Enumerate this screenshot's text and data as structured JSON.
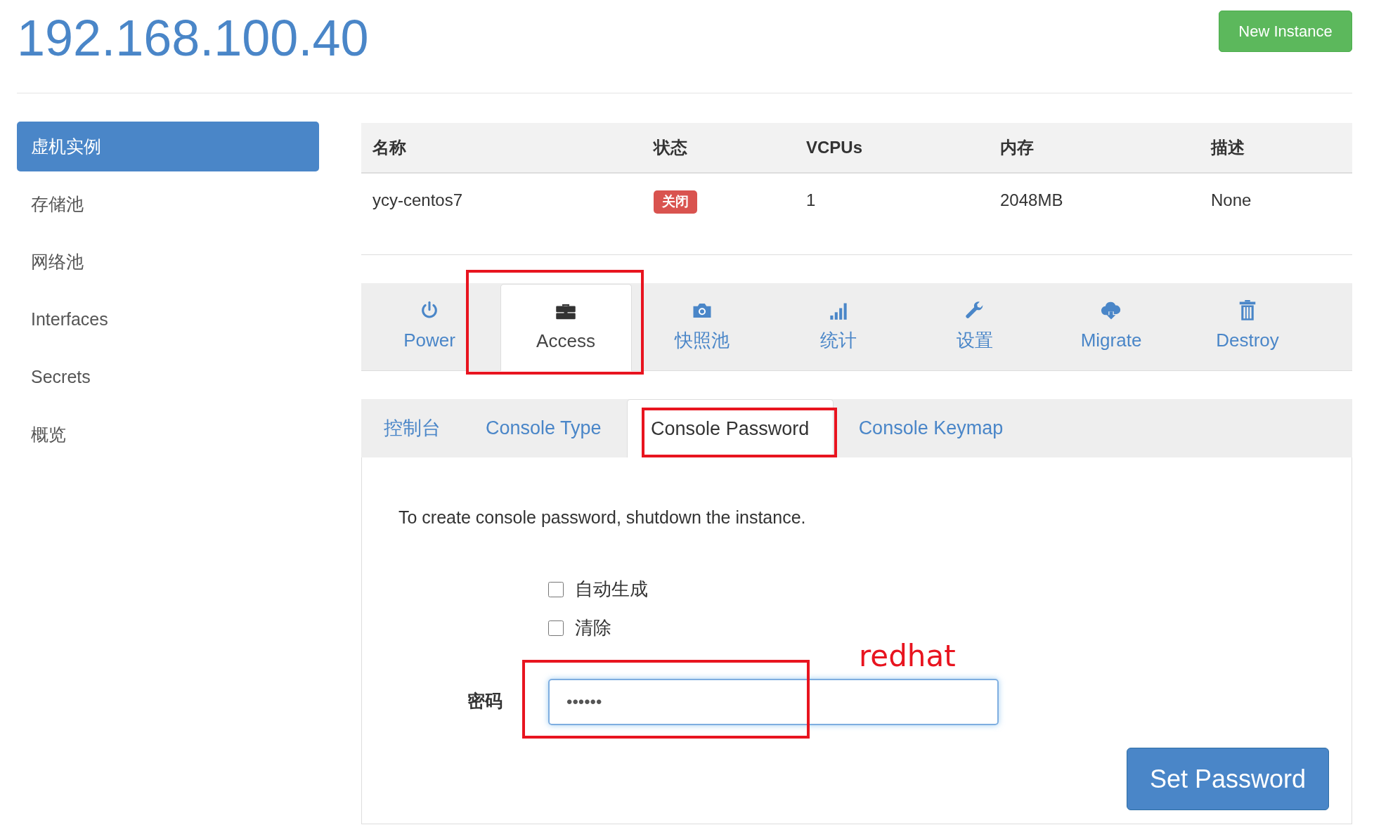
{
  "title": "192.168.100.40",
  "new_instance_button": "New Instance",
  "sidebar": {
    "items": [
      {
        "label": "虚机实例",
        "selected": true
      },
      {
        "label": "存储池",
        "selected": false
      },
      {
        "label": "网络池",
        "selected": false
      },
      {
        "label": "Interfaces",
        "selected": false
      },
      {
        "label": "Secrets",
        "selected": false
      },
      {
        "label": "概览",
        "selected": false
      }
    ]
  },
  "table": {
    "columns": [
      {
        "label": "名称",
        "kind": "text"
      },
      {
        "label": "状态",
        "kind": "badge"
      },
      {
        "label": "VCPUs",
        "kind": "text"
      },
      {
        "label": "内存",
        "kind": "text"
      },
      {
        "label": "描述",
        "kind": "text"
      }
    ],
    "rows": [
      {
        "cells": [
          "ycy-centos7",
          "关闭",
          "1",
          "2048MB",
          "None"
        ],
        "color": "#d9534f"
      }
    ]
  },
  "action_tabs": [
    {
      "label": "Power",
      "selected": false,
      "annotated": false
    },
    {
      "label": "Access",
      "selected": true,
      "annotated": true
    },
    {
      "label": "快照池",
      "selected": false,
      "annotated": false
    },
    {
      "label": "统计",
      "selected": false,
      "annotated": false
    },
    {
      "label": "设置",
      "selected": false,
      "annotated": false
    },
    {
      "label": "Migrate",
      "selected": false,
      "annotated": false
    },
    {
      "label": "Destroy",
      "selected": false,
      "annotated": false
    }
  ],
  "sub_tabs": [
    {
      "label": "控制台",
      "selected": false,
      "annotated": false
    },
    {
      "label": "Console Type",
      "selected": false,
      "annotated": false
    },
    {
      "label": "Console Password",
      "selected": true,
      "annotated": true
    },
    {
      "label": "Console Keymap",
      "selected": false,
      "annotated": false
    }
  ],
  "panel": {
    "message": "To create console password, shutdown the instance.",
    "options": [
      {
        "label": "自动生成",
        "checked": false
      },
      {
        "label": "清除",
        "checked": false
      }
    ],
    "password": {
      "label": "密码",
      "value": "••••••",
      "annotated": true,
      "annotation_text": "redhat"
    },
    "submit_button": "Set Password"
  }
}
